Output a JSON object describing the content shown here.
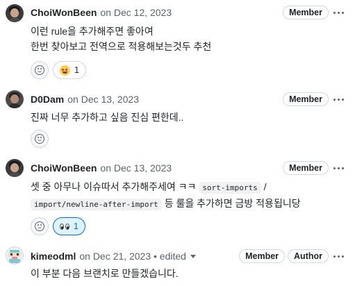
{
  "comments": [
    {
      "author": "ChoiWonBeen",
      "meta": "on Dec 12, 2023",
      "badges": [
        "Member"
      ],
      "lines": [
        "이런 rule을 추가해주면 좋아여",
        "한번 찾아보고 전역으로 적용해보는것두 추천"
      ],
      "reactions": [
        {
          "emoji": "heart-eyes-icon",
          "count": "1"
        }
      ]
    },
    {
      "author": "D0Dam",
      "meta": "on Dec 13, 2023",
      "badges": [
        "Member"
      ],
      "lines": [
        "진짜 너무 추가하고 싶음 진심 편한데.."
      ],
      "reactions": []
    },
    {
      "author": "ChoiWonBeen",
      "meta": "on Dec 13, 2023",
      "badges": [
        "Member"
      ],
      "line1_prefix": "셋 중 아무나 이슈따서 추가해주세여 ㅋㅋ ",
      "line1_code": "sort-imports",
      "line1_sep": " /",
      "line2_code": "import/newline-after-import",
      "line2_suffix": " 등 룰을 추가하면 금방 적용됩니당",
      "reactions": [
        {
          "emoji": "eyes-icon",
          "count": "1"
        }
      ]
    },
    {
      "author": "kimeodml",
      "meta": "on Dec 21, 2023 • edited",
      "badges": [
        "Member",
        "Author"
      ],
      "lines": [
        "이 부분 다음 브랜치로 만들겠습니다."
      ]
    }
  ]
}
